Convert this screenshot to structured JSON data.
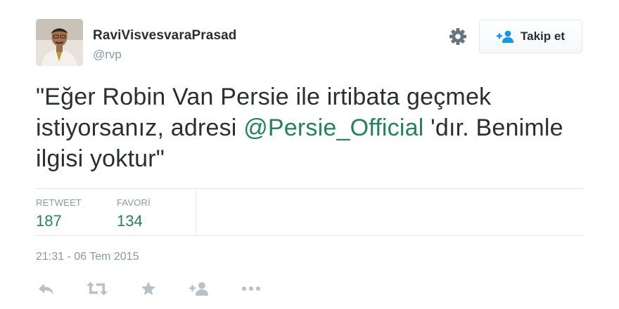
{
  "user": {
    "display_name": "RaviVisvesvaraPrasad",
    "handle": "@rvp"
  },
  "follow_button": {
    "label": "Takip et"
  },
  "tweet": {
    "text_before": "\"Eğer Robin Van Persie ile irtibata geçmek istiyorsanız, adresi ",
    "mention": "@Persie_Official",
    "text_after": " 'dır. Benimle ilgisi yoktur\""
  },
  "stats": {
    "retweet_label": "RETWEET",
    "retweet_count": "187",
    "favorite_label": "FAVORİ",
    "favorite_count": "134"
  },
  "timestamp": "21:31 - 06 Tem 2015",
  "actions": [
    "reply-icon",
    "retweet-icon",
    "favorite-icon",
    "follow-icon",
    "more-icon"
  ],
  "colors": {
    "accent": "#24825c",
    "text": "#292f33",
    "muted": "#8899a6",
    "action_icon": "#b7c1c9",
    "border": "#e1e8ed"
  }
}
